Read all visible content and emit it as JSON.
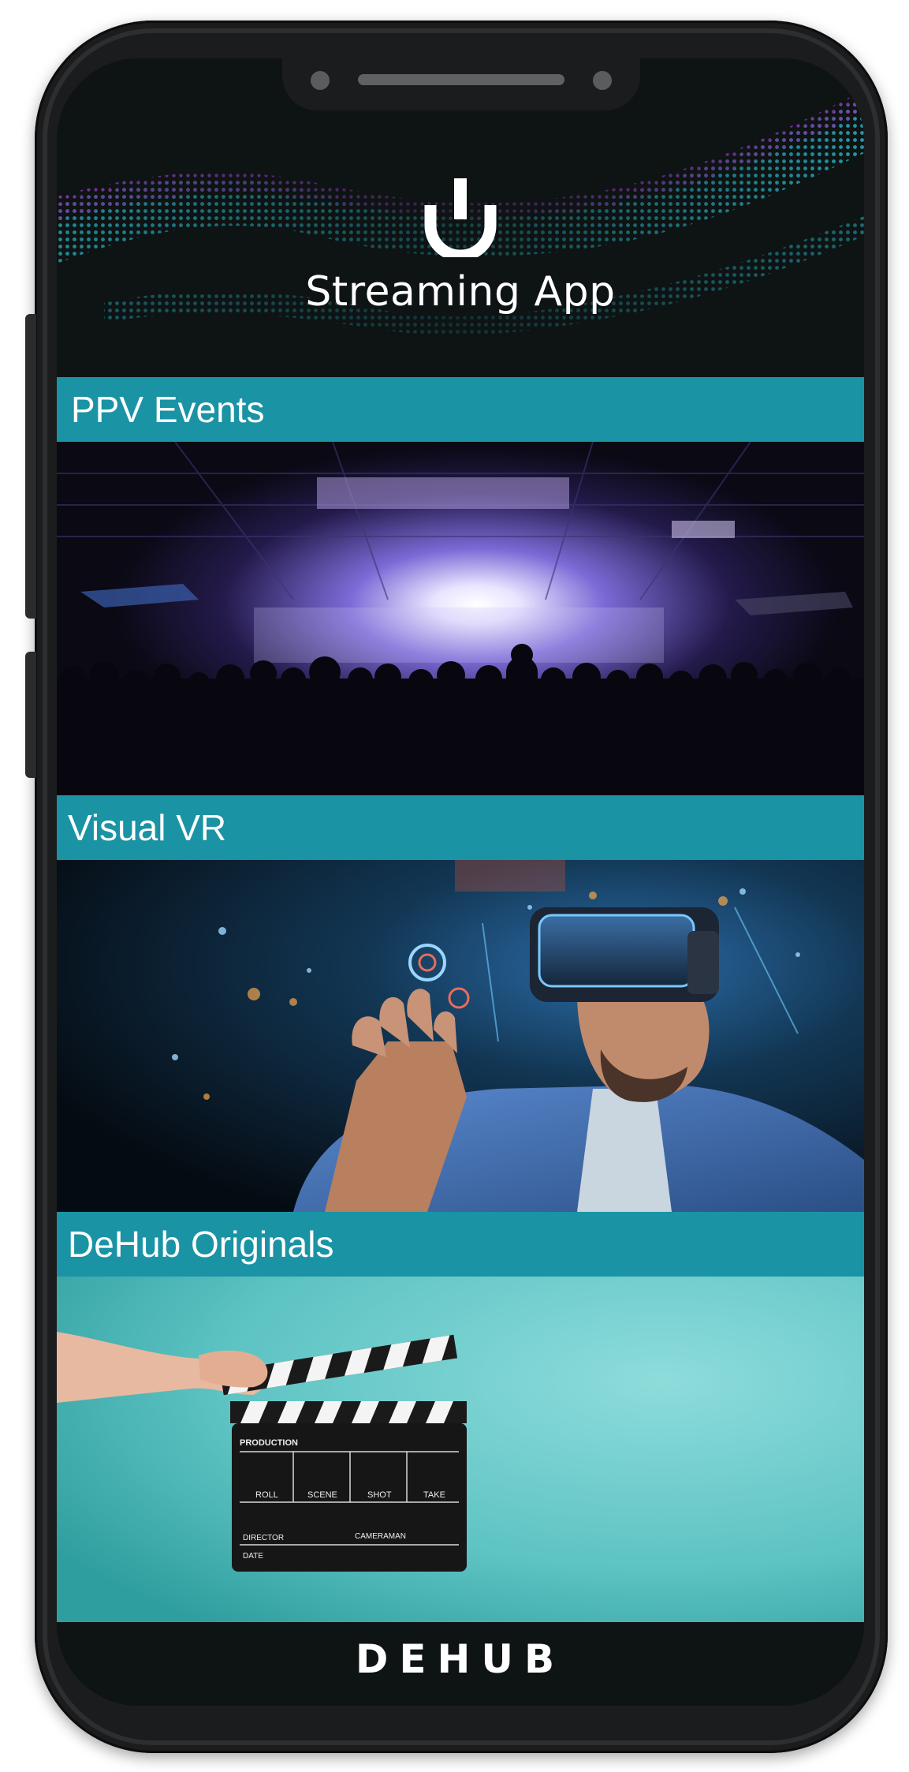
{
  "app": {
    "title": "Streaming App",
    "logo_icon": "power-u-logo-icon",
    "brand_footer": "DEHUB"
  },
  "sections": [
    {
      "label": "PPV Events",
      "image": "concert-crowd-stage-lights"
    },
    {
      "label": "Visual VR",
      "image": "man-wearing-vr-headset"
    },
    {
      "label": "DeHub Originals",
      "image": "hand-holding-clapperboard"
    }
  ],
  "clapperboard": {
    "production": "PRODUCTION",
    "columns": [
      "ROLL",
      "SCENE",
      "SHOT",
      "TAKE"
    ],
    "director": "DIRECTOR",
    "cameraman": "CAMERAMAN",
    "date": "DATE"
  },
  "colors": {
    "accent": "#1a93a5",
    "screen_bg": "#0e1314",
    "wave_teal": "#27b1bf",
    "wave_purple": "#8b3fb5"
  }
}
